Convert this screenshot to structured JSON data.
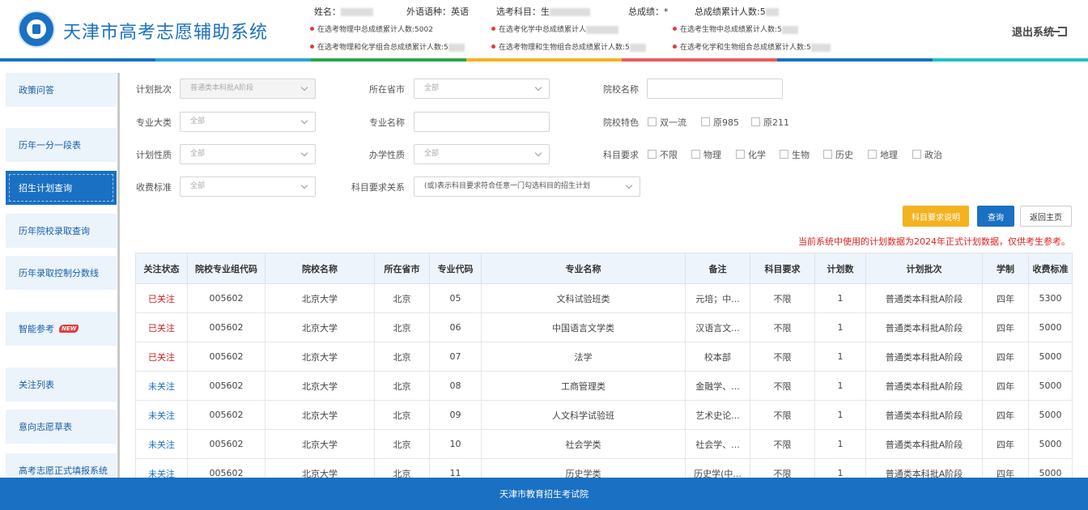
{
  "header": {
    "title": "天津市高考志愿辅助系统",
    "name_label": "姓名：",
    "foreign_lang": "外语语种：英语",
    "subjects_label": "选考科目：生",
    "total_score": "总成绩：*",
    "total_rank": "总成绩累计人数:5",
    "stats": [
      "在选考物理中总成绩累计人数:5002",
      "在选考化学中总成绩累计人",
      "在选考生物中总成绩累计人数:5",
      "在选考物理和化学组合总成绩累计人数:5",
      "在选考物理和生物组合总成绩累计人数:5",
      "在选考化学和生物组合总成绩累计人数:5"
    ],
    "logout": "退出系统",
    "stripe_colors": [
      "#1a70c2",
      "#29a3d8",
      "#2ca44a",
      "#f5b21f",
      "#e95c5c",
      "#1a70c2",
      "#1ec3c0"
    ]
  },
  "sidebar": {
    "items": [
      {
        "label": "政策问答"
      },
      {
        "label": "历年一分一段表"
      },
      {
        "label": "招生计划查询"
      },
      {
        "label": "历年院校录取查询"
      },
      {
        "label": "历年录取控制分数线"
      },
      {
        "label": "智能参考",
        "badge": "NEW"
      },
      {
        "label": "关注列表"
      },
      {
        "label": "意向志愿草表"
      },
      {
        "label": "高考志愿正式填报系统"
      }
    ]
  },
  "form": {
    "plan_batch": {
      "label": "计划批次",
      "value": "普通类本科批A阶段"
    },
    "province": {
      "label": "所在省市",
      "value": "全部"
    },
    "school_name": {
      "label": "院校名称",
      "value": ""
    },
    "major_category": {
      "label": "专业大类",
      "value": "全部"
    },
    "major_name": {
      "label": "专业名称",
      "value": ""
    },
    "school_feature": {
      "label": "院校特色",
      "options": [
        "双一流",
        "原985",
        "原211"
      ]
    },
    "plan_nature": {
      "label": "计划性质",
      "value": "全部"
    },
    "school_type": {
      "label": "办学性质",
      "value": "全部"
    },
    "subject_req": {
      "label": "科目要求",
      "options": [
        "不限",
        "物理",
        "化学",
        "生物",
        "历史",
        "地理",
        "政治"
      ]
    },
    "fee_standard": {
      "label": "收费标准",
      "value": "全部"
    },
    "subject_relation": {
      "label": "科目要求关系",
      "value": "(或)表示科目要求符合任意一门勾选科目的招生计划"
    }
  },
  "buttons": {
    "explain": "科目要求说明",
    "query": "查询",
    "home": "返回主页"
  },
  "notice": "当前系统中使用的计划数据为2024年正式计划数据，仅供考生参考。",
  "table": {
    "headers": [
      "关注状态",
      "院校专业组代码",
      "院校名称",
      "所在省市",
      "专业代码",
      "专业名称",
      "备注",
      "科目要求",
      "计划数",
      "计划批次",
      "学制",
      "收费标准"
    ],
    "rows": [
      [
        "已关注",
        "005602",
        "北京大学",
        "北京",
        "05",
        "文科试验班类",
        "元培；中...",
        "不限",
        "1",
        "普通类本科批A阶段",
        "四年",
        "5300"
      ],
      [
        "已关注",
        "005602",
        "北京大学",
        "北京",
        "06",
        "中国语言文学类",
        "汉语言文...",
        "不限",
        "1",
        "普通类本科批A阶段",
        "四年",
        "5000"
      ],
      [
        "已关注",
        "005602",
        "北京大学",
        "北京",
        "07",
        "法学",
        "校本部",
        "不限",
        "1",
        "普通类本科批A阶段",
        "四年",
        "5000"
      ],
      [
        "未关注",
        "005602",
        "北京大学",
        "北京",
        "08",
        "工商管理类",
        "金融学、...",
        "不限",
        "1",
        "普通类本科批A阶段",
        "四年",
        "5000"
      ],
      [
        "未关注",
        "005602",
        "北京大学",
        "北京",
        "09",
        "人文科学试验班",
        "艺术史论...",
        "不限",
        "1",
        "普通类本科批A阶段",
        "四年",
        "5000"
      ],
      [
        "未关注",
        "005602",
        "北京大学",
        "北京",
        "10",
        "社会学类",
        "社会学、...",
        "不限",
        "1",
        "普通类本科批A阶段",
        "四年",
        "5000"
      ],
      [
        "未关注",
        "005602",
        "北京大学",
        "北京",
        "11",
        "历史学类",
        "历史学(中...",
        "不限",
        "1",
        "普通类本科批A阶段",
        "四年",
        "5000"
      ]
    ]
  },
  "footer": "天津市教育招生考试院"
}
